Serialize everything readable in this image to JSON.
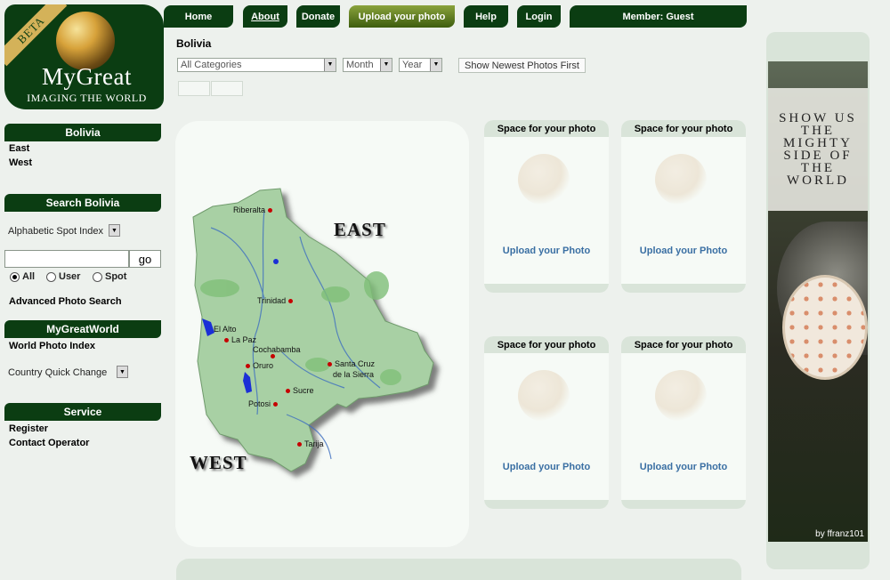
{
  "logo": {
    "badge": "BETA",
    "brand": "MyGreat",
    "tagline": "IMAGING THE WORLD"
  },
  "nav": {
    "home": "Home",
    "about": "About",
    "donate": "Donate",
    "upload": "Upload your photo",
    "help": "Help",
    "login": "Login",
    "member": "Member: Guest"
  },
  "filters": {
    "title": "Bolivia",
    "category": "All Categories",
    "month": "Month",
    "year": "Year",
    "newest": "Show Newest Photos First"
  },
  "sidebar": {
    "region_header": "Bolivia",
    "regions": [
      "East",
      "West"
    ],
    "search_header": "Search Bolivia",
    "spot_index": "Alphabetic Spot Index",
    "go": "go",
    "radios": [
      {
        "label": "All",
        "checked": true
      },
      {
        "label": "User",
        "checked": false
      },
      {
        "label": "Spot",
        "checked": false
      }
    ],
    "advanced": "Advanced Photo Search",
    "world_header": "MyGreatWorld",
    "world_index": "World Photo Index",
    "quick_change": "Country Quick Change",
    "service_header": "Service",
    "register": "Register",
    "contact": "Contact Operator"
  },
  "map": {
    "east": "EAST",
    "west": "WEST",
    "cities": [
      "Riberalta",
      "Trinidad",
      "El Alto",
      "La Paz",
      "Cochabamba",
      "Oruro",
      "Santa Cruz",
      "de la Sierra",
      "Sucre",
      "Potosi",
      "Tarija"
    ]
  },
  "slots": [
    {
      "title": "Space for your photo",
      "link": "Upload your Photo"
    },
    {
      "title": "Space for your photo",
      "link": "Upload your Photo"
    },
    {
      "title": "Space for your photo",
      "link": "Upload your Photo"
    },
    {
      "title": "Space for your photo",
      "link": "Upload your Photo"
    }
  ],
  "ad": {
    "headline": "SHOW US THE MIGHTY SIDE OF THE WORLD",
    "credit": "by ffranz101"
  },
  "colors": {
    "nav_bg": "#0b3d12",
    "panel": "#d9e4d9",
    "page": "#edf1ed",
    "link": "#3a6fa3",
    "pin": "#c60000",
    "map_land": "#a8d0a4"
  }
}
